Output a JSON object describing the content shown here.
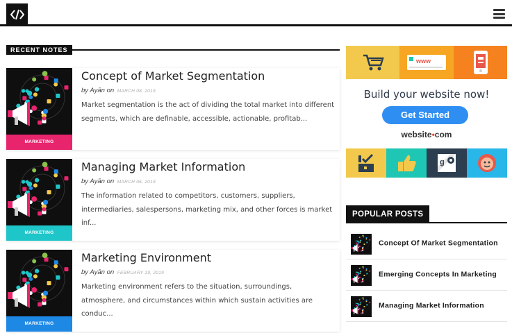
{
  "header": {
    "logo_icon": "code-brackets-icon",
    "menu_icon": "hamburger-menu-icon"
  },
  "section": {
    "title": "RECENT NOTES"
  },
  "posts": [
    {
      "title": "Concept of Market Segmentation",
      "by": "by",
      "author": "Ayān",
      "on": "on",
      "date": "MARCH 08, 2019",
      "excerpt": "Market segmentation is the act of dividing the total market into different segments, which are definable, accessible, actionable, profitab...",
      "thumb_label": "MARKETING",
      "thumb_color": "#e8246c"
    },
    {
      "title": "Managing Market Information",
      "by": "by",
      "author": "Ayān",
      "on": "on",
      "date": "MARCH 06, 2019",
      "excerpt": "The information related to competitors, customers, suppliers, intermediaries, salespersons, marketing mix, and other forces is market inf...",
      "thumb_label": "MARKETING",
      "thumb_color": "#1fc6c9"
    },
    {
      "title": "Marketing Environment",
      "by": "by",
      "author": "Ayān",
      "on": "on",
      "date": "FEBRUARY 19, 2019",
      "excerpt": "Marketing environment refers to the situation, surroundings, atmosphere, and circumstances within which sustain activities are conduc...",
      "thumb_label": "MARKETING",
      "thumb_color": "#1e88e5"
    }
  ],
  "ad": {
    "top_tiles": [
      {
        "icon": "cart-icon",
        "color": "#f2c94c"
      },
      {
        "icon": "www-browser-icon",
        "color": "#f6a623",
        "text": "www"
      },
      {
        "icon": "mobile-phone-icon",
        "color": "#f5821f"
      }
    ],
    "headline": "Build your website now!",
    "button_label": "Get Started",
    "brand_name": "website",
    "brand_suffix": "com",
    "bottom_tiles": [
      {
        "icon": "checklist-icon",
        "color": "#f2c94c"
      },
      {
        "icon": "thumbs-up-icon",
        "color": "#1fc6b3"
      },
      {
        "icon": "google-maps-icon",
        "color": "#2d3e50"
      },
      {
        "icon": "mailchimp-icon",
        "color": "#29b6e8"
      }
    ],
    "accent": "#2f8ef2"
  },
  "popular": {
    "title": "POPULAR POSTS",
    "items": [
      {
        "title": "Concept Of Market Segmentation"
      },
      {
        "title": "Emerging Concepts In Marketing"
      },
      {
        "title": "Managing Market Information"
      }
    ]
  }
}
